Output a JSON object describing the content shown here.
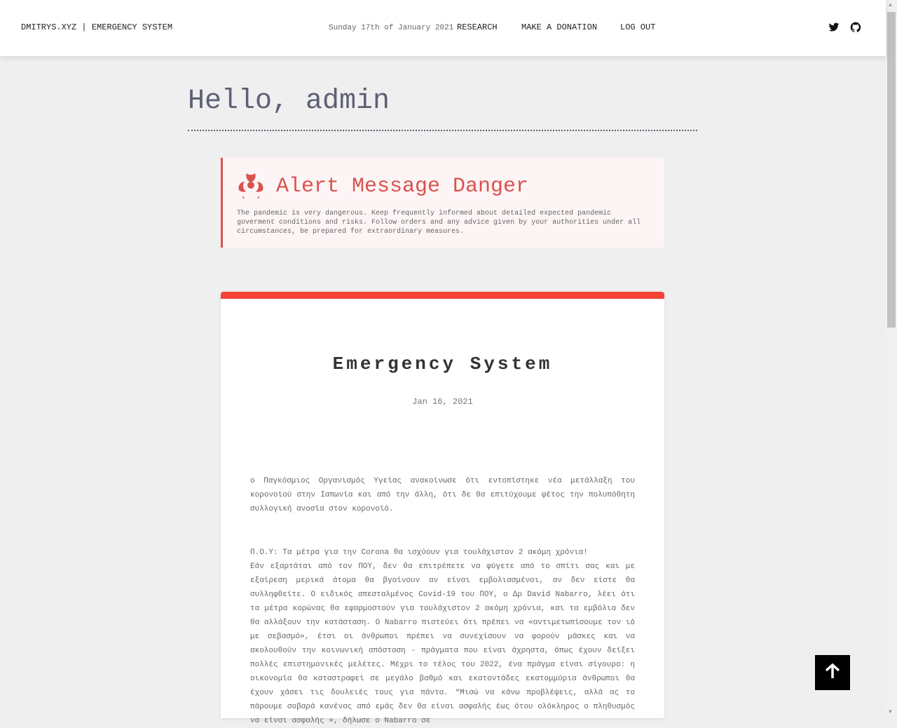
{
  "header": {
    "brand": "DMITRYS.XYZ | EMERGENCY SYSTEM",
    "date": "Sunday 17th of January 2021",
    "nav": [
      "RESEARCH",
      "MAKE A DONATION",
      "LOG OUT"
    ]
  },
  "greeting": "Hello, admin",
  "alert": {
    "icon": "biohazard-icon",
    "title": "Alert Message Danger",
    "text": "The pandemic is very dangerous. Keep frequently informed about detailed expected pandemic goverment conditions and risks. Follow orders and any advice given by your authorities under all circumstances, be prepared for extraordinary measures.",
    "color": "#d9534f"
  },
  "post": {
    "title": "Emergency System",
    "date": "Jan 16, 2021",
    "p1": "ο Παγκόσμιος Οργανισμός Υγείας ανακοίνωσε ότι εντοπίστηκε νέα μετάλλαξη του κορονοϊού στην Ιαπωνία και από την άλλη, ότι δε θα επιτύχουμε φέτος την πολυπόθητη συλλογική ανοσία στον κορονοϊό.",
    "p2_title": "Π.Ο.Υ: Τα μέτρα για την Corona θα ισχύουν για τουλάχιστον 2 ακόμη χρόνια!",
    "p2": "Εάν εξαρτάται από τον ΠΟΥ, δεν θα επιτρέπετε να φύγετε από το σπίτι σας και με εξαίρεση μερικά άτομα θα βγαίνουν αν είναι εμβολιασμένοι, αν δεν είστε θα συλληφθείτε. Ο ειδικός απεσταλμένος Covid-19 του ΠΟΥ, ο Δρ David Nabarro, λέει ότι τα μέτρα κορώνας θα εφαρμοστούν για τουλάχιστον 2 ακόμη χρόνια, και τα εμβόλια δεν θα αλλάξουν την κατάσταση. Ο Nabarro πιστεύει ότι πρέπει να «αντιμετωπίσουμε τον ιό με σεβασμό», έτσι οι άνθρωποι πρέπει να συνεχίσουν να φορούν μάσκες και να ακολουθούν την κοινωνική απόσταση - πράγματα που είναι άχρηστα, όπως έχουν δείξει πολλές επιστημονικές μελέτες. Μέχρι το τέλος του 2022, ένα πράγμα είναι σίγουρο: η οικονομία θα καταστραφεί σε μεγάλο βαθμό και εκατοντάδες εκατομμύρια άνθρωποι θα έχουν χάσει τις δουλειές τους για πάντα. “Μισώ να κάνω προβλέψεις, αλλά ας το πάρουμε σοβαρά κανένας από εμάς δεν θα είναι ασφαλής έως ότου ολόκληρος ο πληθυσμός να είναι ασφαλής », δήλωσε ο Nabarro σε"
  },
  "accent": "#f44336"
}
